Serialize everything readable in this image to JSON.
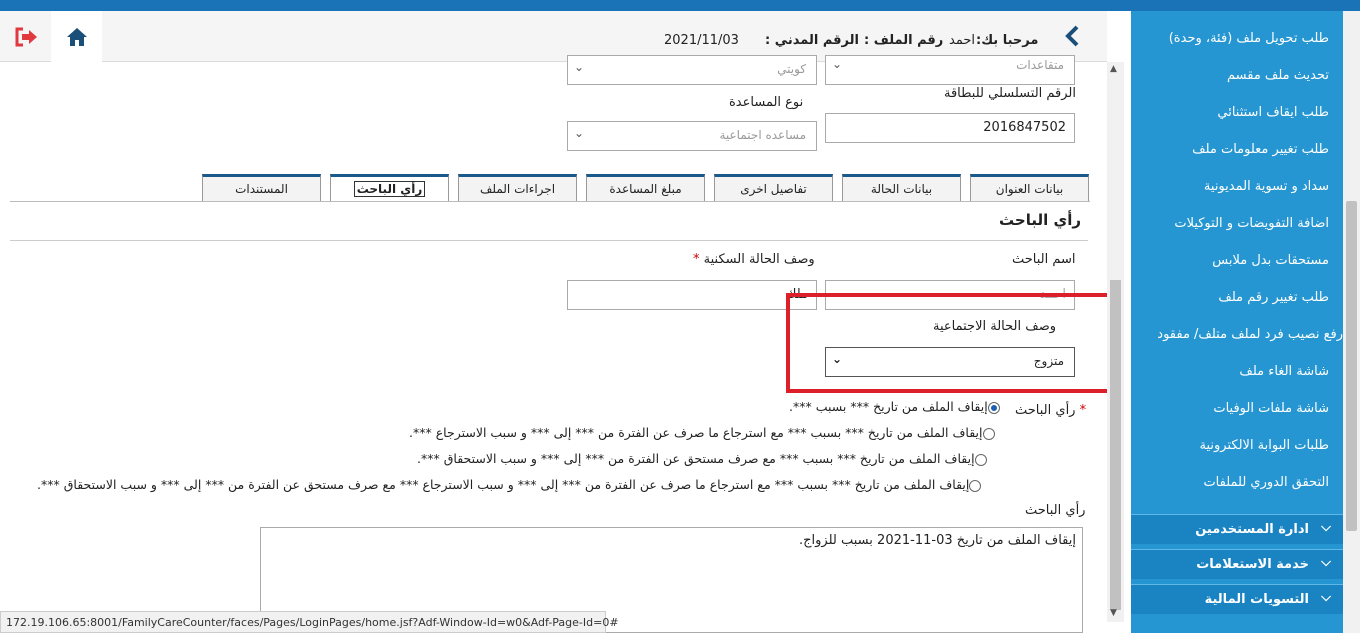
{
  "colors": {
    "sidebar_bg": "#2596d1",
    "section_head_bg": "#1a84c3",
    "highlight": "#dd1f2a",
    "top_strip": "#1a73b6"
  },
  "header": {
    "greeting_label": "مرحبا بك:",
    "greeting_name": "احمد",
    "file_no_label": "رقم الملف :",
    "civil_id_label": "الرقم المدني :",
    "date": "2021/11/03",
    "icons": {
      "logout": "logout-icon",
      "home": "home-icon",
      "back": "chevron-left-icon"
    }
  },
  "form": {
    "nationality_value": "كويتي",
    "top_right_value": "متقاعدات",
    "serial_label": "الرقم التسلسلي للبطاقة",
    "serial_value": "2016847502",
    "aid_type_label": "نوع المساعدة",
    "aid_type_value": "مساعده اجتماعية"
  },
  "tabs": [
    "بيانات العنوان",
    "بيانات الحالة",
    "تفاصيل اخرى",
    "مبلغ المساعدة",
    "اجراءات الملف",
    "رأي الباحث",
    "المستندات"
  ],
  "active_tab": "رأي الباحث",
  "section": {
    "title": "رأي الباحث",
    "researcher_name_label": "اسم الباحث",
    "researcher_name_placeholder": "احمد",
    "housing_label": "وصف الحالة السكنية",
    "housing_value": "ملك",
    "social_label": "وصف الحالة الاجتماعية",
    "social_value": "متزوج",
    "opinion_label": "رأي الباحث",
    "options": [
      "إيقاف الملف من تاريخ *** بسبب ***.",
      "إيقاف الملف من تاريخ *** بسبب *** مع استرجاع ما صرف عن الفترة من *** إلى *** و سبب الاسترجاع ***.",
      "إيقاف الملف من تاريخ *** بسبب *** مع صرف مستحق عن الفترة من *** إلى *** و سبب الاستحقاق ***.",
      "إيقاف الملف من تاريخ *** بسبب *** مع استرجاع ما صرف عن الفترة من *** إلى *** و سبب الاسترجاع *** مع صرف مستحق عن الفترة من *** إلى *** و سبب الاستحقاق ***."
    ],
    "selected_option": 0,
    "opinion_text_label": "رأي الباحث",
    "opinion_text": "إيقاف الملف من تاريخ 03-11-2021 بسبب للزواج."
  },
  "sidebar": {
    "items": [
      "طلب تحويل ملف (فئة، وحدة)",
      "تحديث ملف مقسم",
      "طلب ايقاف استثنائي",
      "طلب تغيير معلومات ملف",
      "سداد و تسوية المديونية",
      "اضافة التفويضات و التوكيلات",
      "مستحقات بدل ملابس",
      "طلب تغيير رقم ملف",
      "رفع نصيب فرد لملف متلف/ مفقود",
      "شاشة الغاء ملف",
      "شاشة ملفات الوفيات",
      "طلبات البوابة الالكترونية",
      "التحقق الدوري للملفات"
    ],
    "sections": [
      "ادارة المستخدمين",
      "خدمة الاستعلامات",
      "التسويات المالية"
    ]
  },
  "statusbar": {
    "url": "172.19.106.65:8001/FamilyCareCounter/faces/Pages/LoginPages/home.jsf?Adf-Window-Id=w0&Adf-Page-Id=0#"
  }
}
